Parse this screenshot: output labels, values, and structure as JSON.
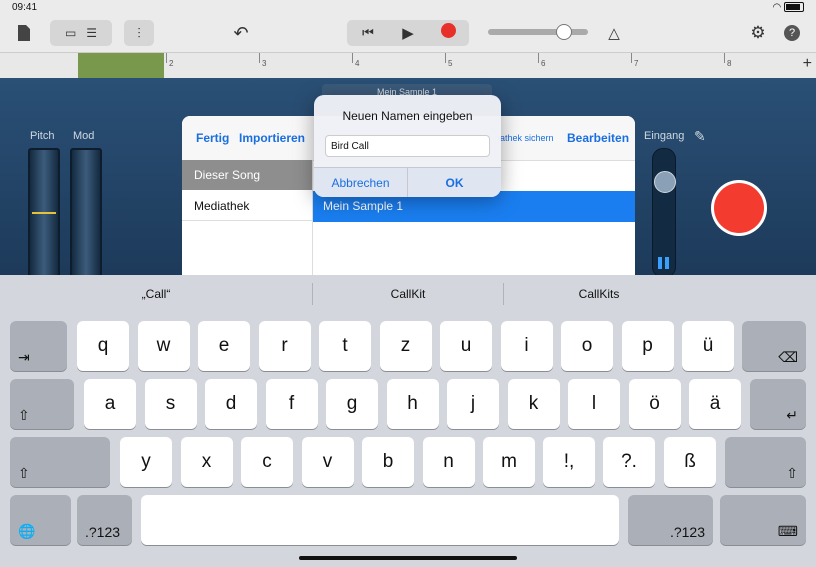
{
  "status": {
    "time": "09:41"
  },
  "ruler": {
    "ticks": [
      "2",
      "3",
      "4",
      "5",
      "6",
      "7",
      "8"
    ]
  },
  "instrument": {
    "pitch_label": "Pitch",
    "mod_label": "Mod",
    "input_label": "Eingang"
  },
  "panel": {
    "done": "Fertig",
    "import": "Importieren",
    "save_library": "iathek sichern",
    "edit": "Bearbeiten",
    "hidden_title": "Mein Sample 1",
    "sidebar": [
      "Dieser Song",
      "Mediathek"
    ],
    "list_item": "Mein Sample 1"
  },
  "dialog": {
    "title": "Neuen Namen eingeben",
    "value": "Bird Call",
    "cancel": "Abbrechen",
    "ok": "OK"
  },
  "suggestions": [
    "„Call“",
    "CallKit",
    "CallKits"
  ],
  "keyboard": {
    "row1": [
      "q",
      "w",
      "e",
      "r",
      "t",
      "z",
      "u",
      "i",
      "o",
      "p",
      "ü"
    ],
    "row2": [
      "a",
      "s",
      "d",
      "f",
      "g",
      "h",
      "j",
      "k",
      "l",
      "ö",
      "ä"
    ],
    "row3": [
      "y",
      "x",
      "c",
      "v",
      "b",
      "n",
      "m"
    ],
    "punct1": "!,",
    "punct2": "?.",
    "sz": "ß",
    "numbers": ".?123",
    "tab": "⇥",
    "delete": "⌫",
    "shift": "⇧",
    "return": "↵",
    "globe": "🌐",
    "hide": "⌨"
  }
}
